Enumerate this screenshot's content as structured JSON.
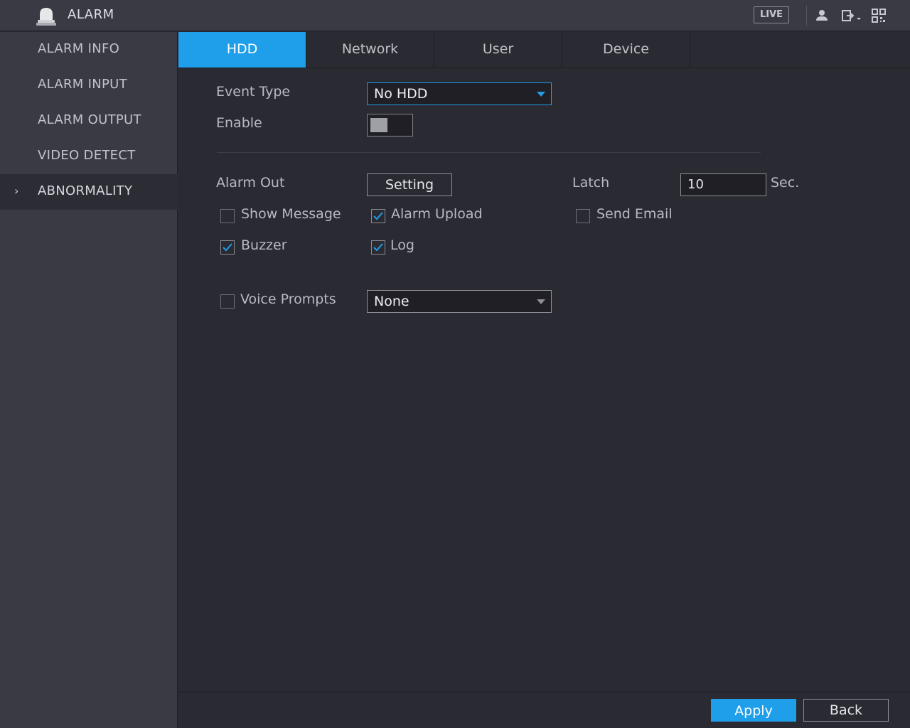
{
  "header": {
    "title": "ALARM",
    "live_label": "LIVE",
    "icons": [
      "alarm-bell-icon",
      "user-icon",
      "logout-icon",
      "qr-code-icon"
    ]
  },
  "sidebar": {
    "items": [
      {
        "label": "ALARM INFO"
      },
      {
        "label": "ALARM INPUT"
      },
      {
        "label": "ALARM OUTPUT"
      },
      {
        "label": "VIDEO DETECT"
      },
      {
        "label": "ABNORMALITY",
        "active": true
      }
    ]
  },
  "tabs": [
    {
      "label": "HDD",
      "active": true
    },
    {
      "label": "Network"
    },
    {
      "label": "User"
    },
    {
      "label": "Device"
    }
  ],
  "form": {
    "event_type_label": "Event Type",
    "event_type_value": "No HDD",
    "enable_label": "Enable",
    "enable_on": false,
    "alarm_out_label": "Alarm Out",
    "setting_button": "Setting",
    "latch_label": "Latch",
    "latch_value": "10",
    "latch_unit": "Sec.",
    "show_message_label": "Show Message",
    "show_message_checked": false,
    "alarm_upload_label": "Alarm Upload",
    "alarm_upload_checked": true,
    "send_email_label": "Send Email",
    "send_email_checked": false,
    "buzzer_label": "Buzzer",
    "buzzer_checked": true,
    "log_label": "Log",
    "log_checked": true,
    "voice_prompts_label": "Voice Prompts",
    "voice_prompts_checked": false,
    "voice_prompts_value": "None"
  },
  "footer": {
    "apply_label": "Apply",
    "back_label": "Back"
  },
  "colors": {
    "accent": "#1f9eea",
    "background": "#2a2a33",
    "panel": "#393a44"
  }
}
